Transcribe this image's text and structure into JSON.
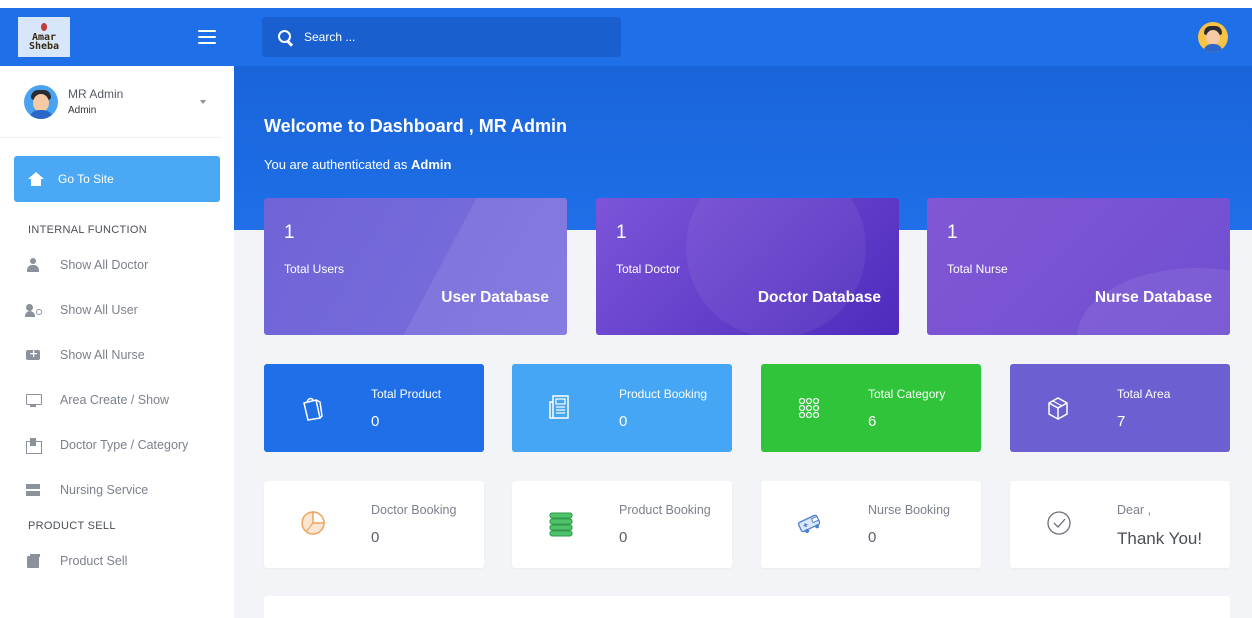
{
  "sidebar": {
    "logo_line1": "Amar",
    "logo_line2": "Sheba",
    "user_name": "MR Admin",
    "user_role": "Admin",
    "goto_label": "Go To Site",
    "section_internal": "INTERNAL FUNCTION",
    "items": [
      {
        "label": "Show All Doctor",
        "icon": "doctor-icon"
      },
      {
        "label": "Show All User",
        "icon": "users-icon"
      },
      {
        "label": "Show All Nurse",
        "icon": "ambulance-icon"
      },
      {
        "label": "Area Create / Show",
        "icon": "monitor-icon"
      },
      {
        "label": "Doctor Type / Category",
        "icon": "briefcase-icon"
      },
      {
        "label": "Nursing Service",
        "icon": "server-icon"
      }
    ],
    "section_product": "PRODUCT SELL",
    "product_items": [
      {
        "label": "Product Sell",
        "icon": "product-icon"
      }
    ]
  },
  "topbar": {
    "search_placeholder": "Search ..."
  },
  "hero": {
    "title": "Welcome to Dashboard , MR Admin",
    "subtitle_prefix": "You are authenticated as",
    "subtitle_role": "Admin"
  },
  "db_cards": [
    {
      "count": "1",
      "label": "Total Users",
      "link": "User Database"
    },
    {
      "count": "1",
      "label": "Total Doctor",
      "link": "Doctor Database"
    },
    {
      "count": "1",
      "label": "Total Nurse",
      "link": "Nurse Database"
    }
  ],
  "stat_cards": [
    {
      "label": "Total Product",
      "value": "0",
      "color": "#1e6fe8"
    },
    {
      "label": "Product Booking",
      "value": "0",
      "color": "#45a6f5"
    },
    {
      "label": "Total Category",
      "value": "6",
      "color": "#2fc43a"
    },
    {
      "label": "Total Area",
      "value": "7",
      "color": "#6b5fd2"
    }
  ],
  "white_cards": [
    {
      "label": "Doctor Booking",
      "value": "0"
    },
    {
      "label": "Product Booking",
      "value": "0"
    },
    {
      "label": "Nurse Booking",
      "value": "0"
    },
    {
      "label": "Dear ,",
      "value": "Thank You!"
    }
  ],
  "colors": {
    "primary": "#1e6fe8",
    "accent_blue": "#4aa8f4",
    "green": "#2fc43a",
    "purple": "#6b5fd2"
  }
}
